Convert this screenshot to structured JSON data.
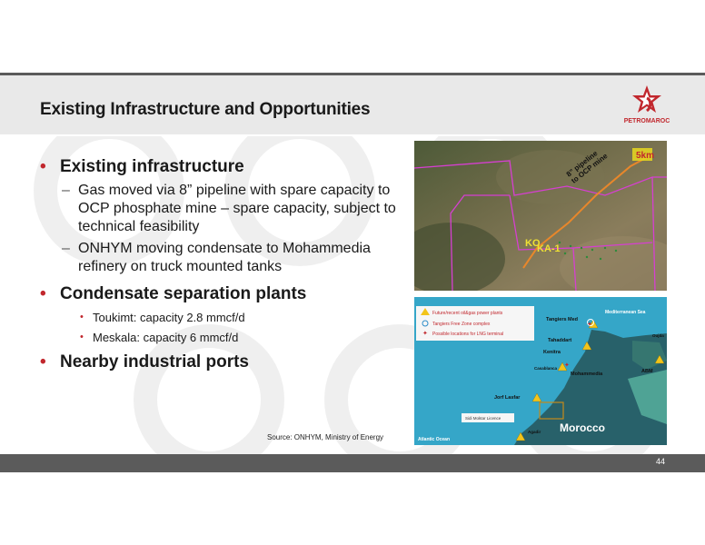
{
  "header": {
    "title": "Existing Infrastructure and Opportunities",
    "logo_text": "PETROMAROC"
  },
  "bullets": [
    {
      "text": "Existing infrastructure",
      "subs": [
        "Gas moved via 8” pipeline with spare capacity to OCP phosphate mine – spare capacity, subject to technical feasibility",
        "ONHYM moving condensate to Mohammedia refinery on truck mounted tanks"
      ]
    },
    {
      "text": "Condensate separation plants",
      "subs": [
        "Toukimt: capacity 2.8 mmcf/d",
        "Meskala: capacity 6 mmcf/d"
      ]
    },
    {
      "text": "Nearby industrial ports"
    }
  ],
  "source": "Source: ONHYM, Ministry of Energy",
  "map_top": {
    "scale": "5km",
    "pipeline": "8” pipeline to OCP mine",
    "pipeline_line1": "8” pipeline",
    "pipeline_line2": "to OCP mine",
    "label_ko": "KO",
    "label_ka": "KA-1"
  },
  "map_bottom": {
    "legend": [
      "Future/recent oil&gas power plants",
      "Tangiers Free Zone complex",
      "Possible locations for LNG terminal"
    ],
    "sea_top": "Mediterranean Sea",
    "sea_bottom": "Atlantic Ocean",
    "country": "Morocco",
    "licence": "Sidi Moktar Licence",
    "cities": [
      "Tangiers Med",
      "Tahaddart",
      "Kenitra",
      "Casablanca",
      "Mohammedia",
      "Jorf Lasfar",
      "Agadir",
      "Oujda",
      "ABM"
    ]
  },
  "footer": {
    "page_number": "44"
  },
  "colors": {
    "accent": "#c1272d",
    "bar": "#5b5b5b",
    "title_band": "#e9e9e9",
    "map_sea": "#35a6c8",
    "map_land": "#28616a"
  }
}
